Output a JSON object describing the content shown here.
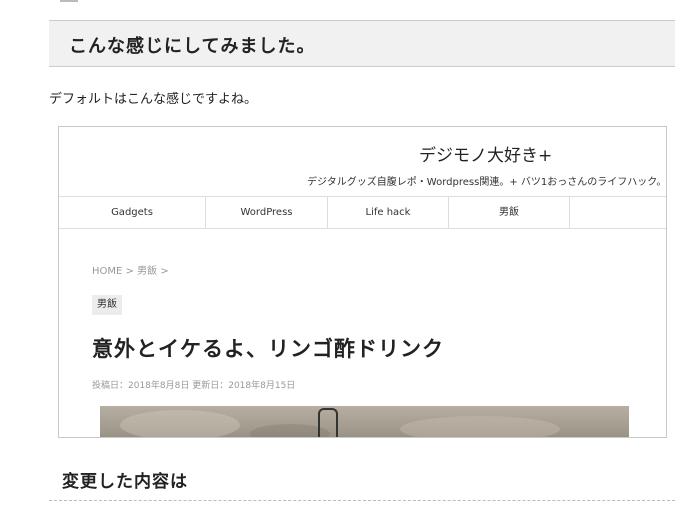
{
  "article": {
    "heading2": "こんな感じにしてみました。",
    "paragraph": "デフォルトはこんな感じですよね。",
    "heading3": "変更した内容は"
  },
  "screenshot": {
    "site_title": "デジモノ大好き+",
    "site_description": "デジタルグッズ自腹レポ・Wordpress関連。+ バツ1おっさんのライフハック。",
    "nav": [
      "Gadgets",
      "WordPress",
      "Life hack",
      "男飯"
    ],
    "breadcrumb": "HOME > 男飯 >",
    "category_badge": "男飯",
    "post_title": "意外とイケるよ、リンゴ酢ドリンク",
    "post_dates": "投稿日：2018年8月8日 更新日：2018年8月15日"
  }
}
